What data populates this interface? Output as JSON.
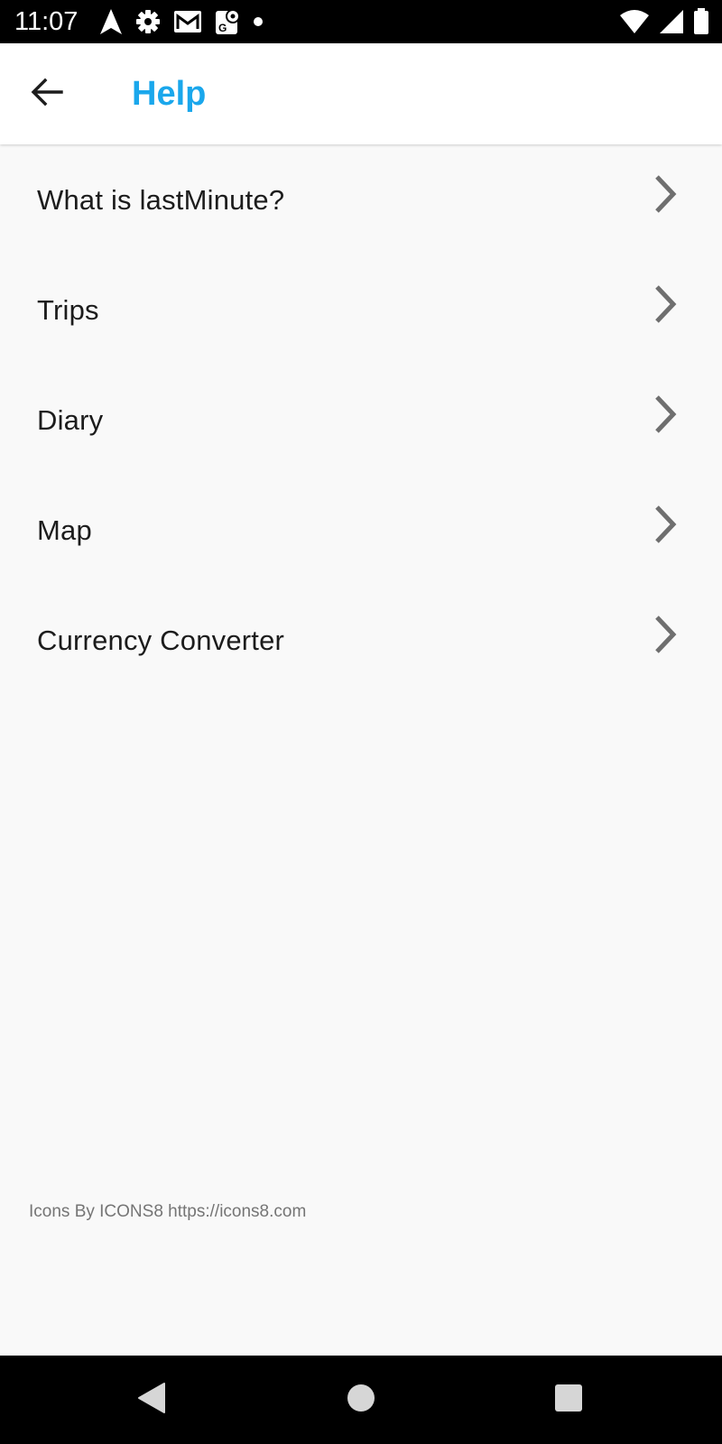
{
  "status_bar": {
    "time": "11:07",
    "left_icons": [
      "navigation-icon",
      "settings-icon",
      "gmail-icon",
      "maps-icon",
      "notification-dot-icon"
    ],
    "right_icons": [
      "wifi-icon",
      "cell-signal-icon",
      "battery-icon"
    ]
  },
  "app_bar": {
    "back_icon": "arrow-back-icon",
    "title": "Help",
    "title_color": "#1aa7ec"
  },
  "help_items": [
    {
      "label": "What is lastMinute?",
      "icon": "chevron-right-icon"
    },
    {
      "label": "Trips",
      "icon": "chevron-right-icon"
    },
    {
      "label": "Diary",
      "icon": "chevron-right-icon"
    },
    {
      "label": "Map",
      "icon": "chevron-right-icon"
    },
    {
      "label": "Currency Converter",
      "icon": "chevron-right-icon"
    }
  ],
  "footer": {
    "credit": "Icons By ICONS8 https://icons8.com"
  },
  "nav_bar": {
    "buttons": [
      "back-triangle-icon",
      "home-circle-icon",
      "recents-square-icon"
    ]
  },
  "colors": {
    "background": "#f9f9f9",
    "app_bar": "#ffffff",
    "accent": "#1aa7ec",
    "chevron": "#6f6f6f",
    "system_bars": "#000000"
  }
}
